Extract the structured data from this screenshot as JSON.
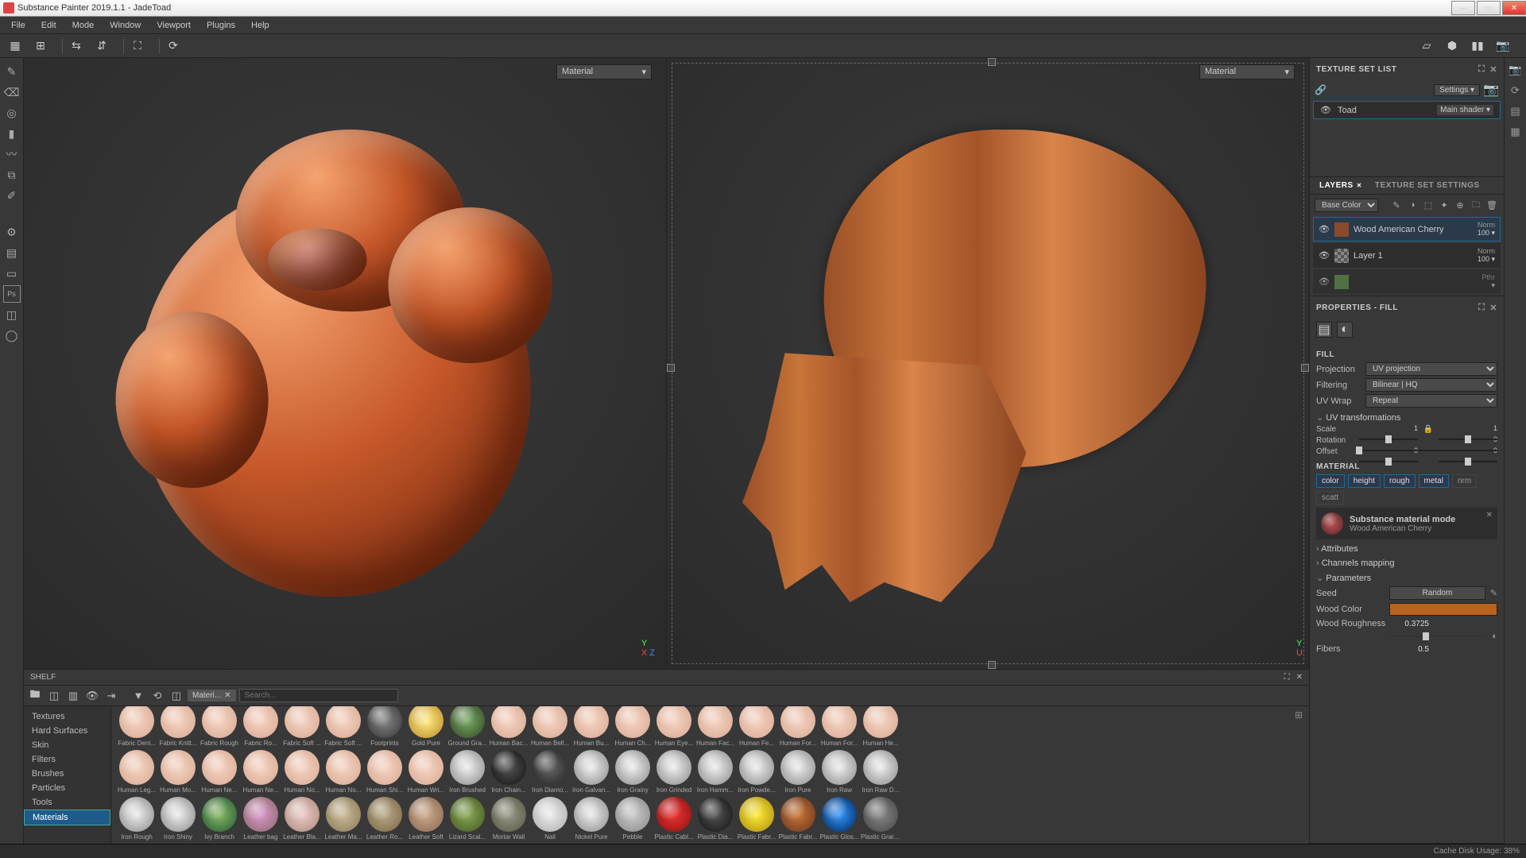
{
  "window": {
    "title": "Substance Painter 2019.1.1 - JadeToad"
  },
  "menu": [
    "File",
    "Edit",
    "Mode",
    "Window",
    "Viewport",
    "Plugins",
    "Help"
  ],
  "viewport_dropdown": "Material",
  "texture_set_list": {
    "title": "TEXTURE SET LIST",
    "settings": "Settings",
    "item": {
      "name": "Toad",
      "shader": "Main shader"
    }
  },
  "layers_panel": {
    "tabs": [
      "LAYERS",
      "TEXTURE SET SETTINGS"
    ],
    "channel": "Base Color",
    "layers": [
      {
        "name": "Wood American Cherry",
        "blend": "Norm",
        "opacity": "100",
        "selected": true,
        "thumb": "wood"
      },
      {
        "name": "Layer 1",
        "blend": "Norm",
        "opacity": "100",
        "thumb": "check"
      },
      {
        "name": "",
        "blend": "Pthr",
        "opacity": "",
        "thumb": "folder"
      }
    ]
  },
  "properties": {
    "title": "PROPERTIES - FILL",
    "fill_title": "FILL",
    "projection_lbl": "Projection",
    "projection": "UV projection",
    "filtering_lbl": "Filtering",
    "filtering": "Bilinear | HQ",
    "uvwrap_lbl": "UV Wrap",
    "uvwrap": "Repeat",
    "uvtrans": "UV transformations",
    "scale_lbl": "Scale",
    "scale": [
      "1",
      "1"
    ],
    "rotation_lbl": "Rotation",
    "rotation": "0",
    "offset_lbl": "Offset",
    "offset": [
      "0",
      "0"
    ],
    "material_title": "MATERIAL",
    "channels": [
      "color",
      "height",
      "rough",
      "metal",
      "nrm",
      "scatt"
    ],
    "mat_mode": "Substance material mode",
    "mat_name": "Wood American Cherry",
    "attributes": "Attributes",
    "ch_mapping": "Channels mapping",
    "parameters": "Parameters",
    "seed_lbl": "Seed",
    "seed": "Random",
    "woodcolor_lbl": "Wood Color",
    "woodrough_lbl": "Wood Roughness",
    "woodrough": "0.3725",
    "fibers_lbl": "Fibers",
    "fibers": "0.5"
  },
  "shelf": {
    "title": "SHELF",
    "tag": "Materi...",
    "search_ph": "Search...",
    "cats": [
      "Textures",
      "Hard Surfaces",
      "Skin",
      "Filters",
      "Brushes",
      "Particles",
      "Tools",
      "Materials"
    ],
    "row1_labels": [
      "Fabric Deni...",
      "Fabric Knitt...",
      "Fabric Rough",
      "Fabric Ro...",
      "Fabric Soft ...",
      "Fabric Soft ...",
      "Footprints",
      "Gold Pure",
      "Ground Gra...",
      "Human Bac...",
      "Human Bell...",
      "Human Bu...",
      "Human Ch...",
      "Human Eye...",
      "Human Fac...",
      "Human Fe...",
      "Human For...",
      "Human For...",
      "Human He..."
    ],
    "row2_labels": [
      "Human Leg...",
      "Human Mo...",
      "Human Ne...",
      "Human Ne...",
      "Human No...",
      "Human No...",
      "Human Shi...",
      "Human Wri...",
      "Iron Brushed",
      "Iron Chain...",
      "Iron Diamo...",
      "Iron Galvan...",
      "Iron Grainy",
      "Iron Grinded",
      "Iron Hamm...",
      "Iron Powde...",
      "Iron Pure",
      "Iron Raw",
      "Iron Raw D..."
    ],
    "row3_labels": [
      "Iron Rough",
      "Iron Shiny",
      "Ivy Branch",
      "Leather bag",
      "Leather Bla...",
      "Leather Ma...",
      "Leather Ro...",
      "Leather Soft",
      "Lizard Scal...",
      "Mortar Wall",
      "Nail",
      "Nickel Pure",
      "Pebble",
      "Plastic Cabl...",
      "Plastic Dia...",
      "Plastic Fabr...",
      "Plastic Fabr...",
      "Plastic Glos...",
      "Plastic Grain..."
    ]
  },
  "status": {
    "cache": "Cache Disk Usage:  38%"
  }
}
